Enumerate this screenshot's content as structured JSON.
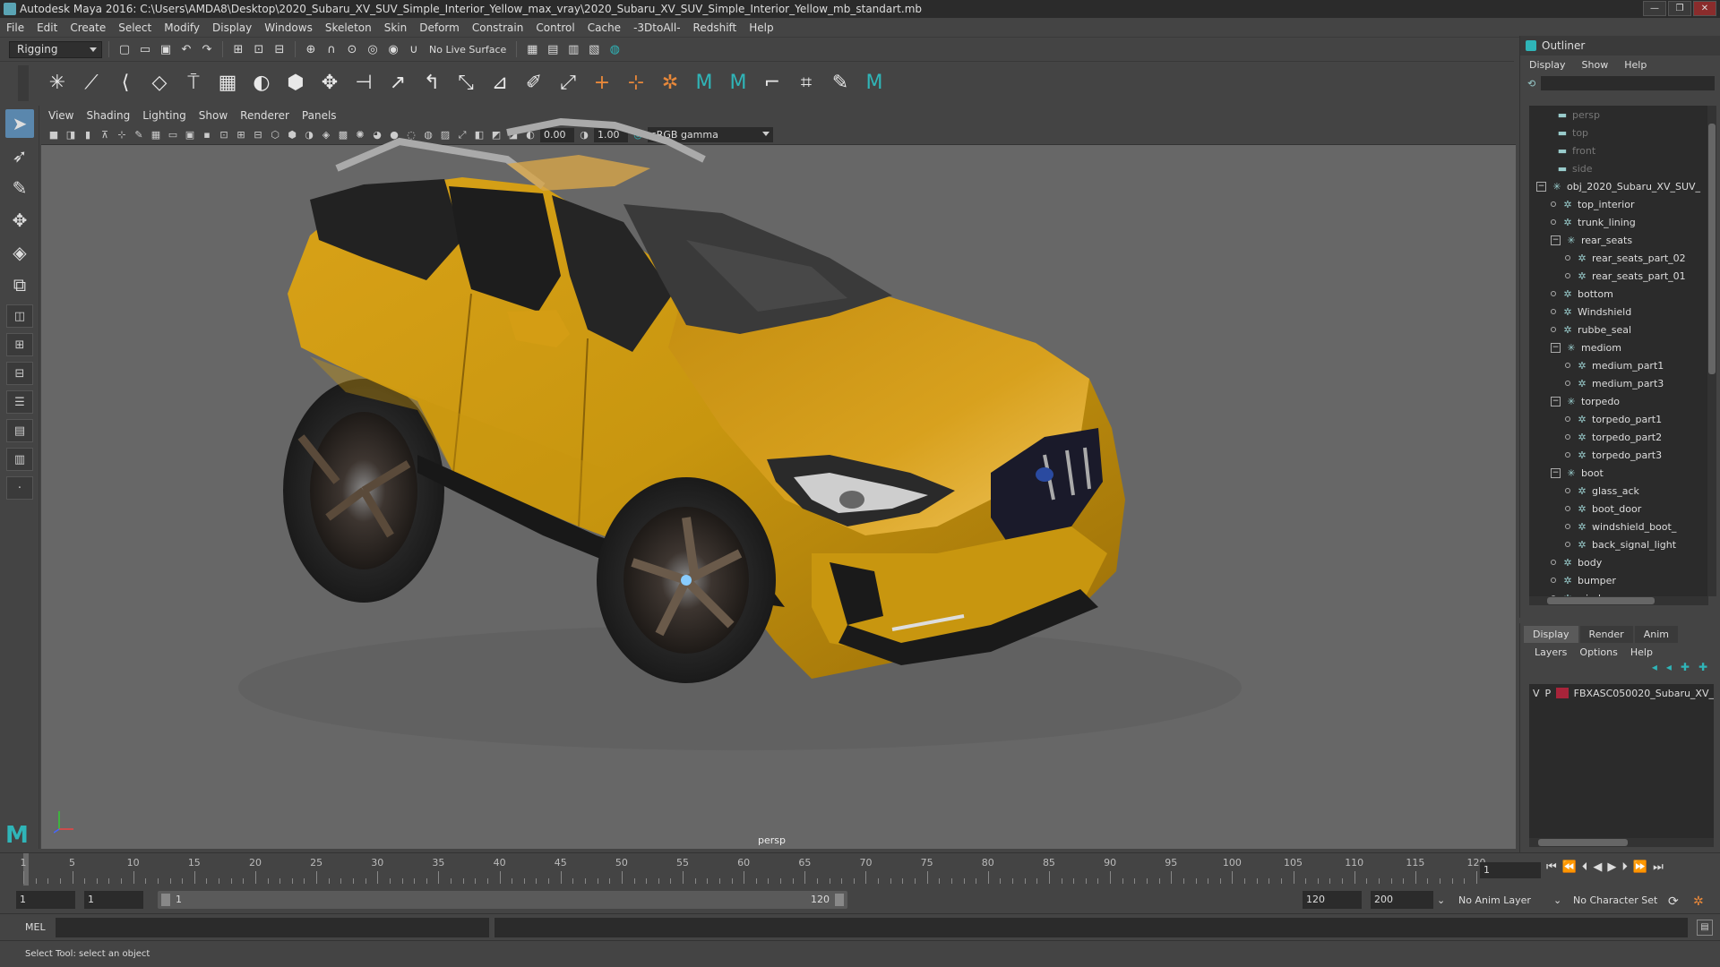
{
  "window": {
    "title": "Autodesk Maya 2016: C:\\Users\\AMDA8\\Desktop\\2020_Subaru_XV_SUV_Simple_Interior_Yellow_max_vray\\2020_Subaru_XV_SUV_Simple_Interior_Yellow_mb_standart.mb"
  },
  "menubar": [
    "File",
    "Edit",
    "Create",
    "Select",
    "Modify",
    "Display",
    "Windows",
    "Skeleton",
    "Skin",
    "Deform",
    "Constrain",
    "Control",
    "Cache",
    "-3DtoAll-",
    "Redshift",
    "Help"
  ],
  "statusline": {
    "mode": "Rigging",
    "live_surface": "No Live Surface"
  },
  "viewport": {
    "menu": [
      "View",
      "Shading",
      "Lighting",
      "Show",
      "Renderer",
      "Panels"
    ],
    "exposure": "0.00",
    "gamma": "1.00",
    "color_space": "sRGB gamma",
    "camera": "persp"
  },
  "outliner": {
    "title": "Outliner",
    "menu": [
      "Display",
      "Show",
      "Help"
    ],
    "items": [
      {
        "label": "persp",
        "depth": 0,
        "kind": "camera",
        "dim": true
      },
      {
        "label": "top",
        "depth": 0,
        "kind": "camera",
        "dim": true
      },
      {
        "label": "front",
        "depth": 0,
        "kind": "camera",
        "dim": true
      },
      {
        "label": "side",
        "depth": 0,
        "kind": "camera",
        "dim": true
      },
      {
        "label": "obj_2020_Subaru_XV_SUV_",
        "depth": 0,
        "kind": "group",
        "expand": "−"
      },
      {
        "label": "top_interior",
        "depth": 1,
        "kind": "mesh"
      },
      {
        "label": "trunk_lining",
        "depth": 1,
        "kind": "mesh"
      },
      {
        "label": "rear_seats",
        "depth": 1,
        "kind": "group",
        "expand": "−"
      },
      {
        "label": "rear_seats_part_02",
        "depth": 2,
        "kind": "mesh"
      },
      {
        "label": "rear_seats_part_01",
        "depth": 2,
        "kind": "mesh"
      },
      {
        "label": "bottom",
        "depth": 1,
        "kind": "mesh"
      },
      {
        "label": "Windshield",
        "depth": 1,
        "kind": "mesh"
      },
      {
        "label": "rubbe_seal",
        "depth": 1,
        "kind": "mesh"
      },
      {
        "label": "mediom",
        "depth": 1,
        "kind": "group",
        "expand": "−"
      },
      {
        "label": "medium_part1",
        "depth": 2,
        "kind": "mesh"
      },
      {
        "label": "medium_part3",
        "depth": 2,
        "kind": "mesh"
      },
      {
        "label": "torpedo",
        "depth": 1,
        "kind": "group",
        "expand": "−"
      },
      {
        "label": "torpedo_part1",
        "depth": 2,
        "kind": "mesh"
      },
      {
        "label": "torpedo_part2",
        "depth": 2,
        "kind": "mesh"
      },
      {
        "label": "torpedo_part3",
        "depth": 2,
        "kind": "mesh"
      },
      {
        "label": "boot",
        "depth": 1,
        "kind": "group",
        "expand": "−"
      },
      {
        "label": "glass_ack",
        "depth": 2,
        "kind": "mesh"
      },
      {
        "label": "boot_door",
        "depth": 2,
        "kind": "mesh"
      },
      {
        "label": "windshield_boot_",
        "depth": 2,
        "kind": "mesh"
      },
      {
        "label": "back_signal_light",
        "depth": 2,
        "kind": "mesh"
      },
      {
        "label": "body",
        "depth": 1,
        "kind": "mesh"
      },
      {
        "label": "bumper",
        "depth": 1,
        "kind": "mesh"
      },
      {
        "label": "wind",
        "depth": 1,
        "kind": "mesh"
      }
    ]
  },
  "layers": {
    "tabs": [
      "Display",
      "Render",
      "Anim"
    ],
    "menu": [
      "Layers",
      "Options",
      "Help"
    ],
    "rows": [
      {
        "v": "V",
        "p": "P",
        "name": "FBXASC050020_Subaru_XV_",
        "color": "#a8243a"
      }
    ]
  },
  "timeline": {
    "ticks": [
      1,
      5,
      10,
      15,
      20,
      25,
      30,
      35,
      40,
      45,
      50,
      55,
      60,
      65,
      70,
      75,
      80,
      85,
      90,
      95,
      100,
      105,
      110,
      115,
      120
    ],
    "current_frame": "1"
  },
  "range": {
    "start": "1",
    "playback_start": "1",
    "slider_start": "1",
    "slider_end": "120",
    "playback_end": "120",
    "end": "200",
    "anim_layer": "No Anim Layer",
    "character_set": "No Character Set"
  },
  "cmdline": {
    "label": "MEL"
  },
  "help": {
    "text": "Select Tool: select an object"
  },
  "colors": {
    "car_body": "#c8960f",
    "accent": "#2fb5b8"
  }
}
